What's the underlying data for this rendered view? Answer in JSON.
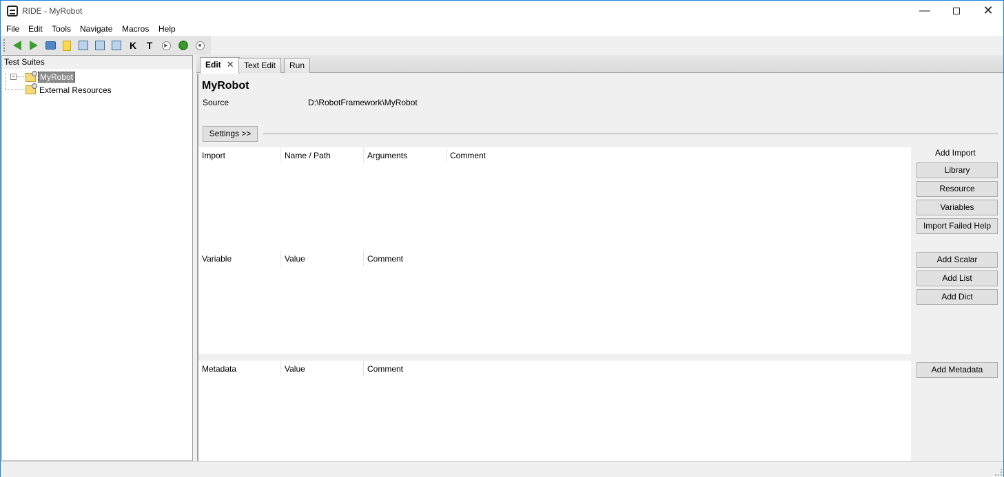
{
  "window": {
    "title": "RIDE - MyRobot",
    "minimize_glyph": "—",
    "close_glyph": "✕"
  },
  "menu": [
    "File",
    "Edit",
    "Tools",
    "Navigate",
    "Macros",
    "Help"
  ],
  "toolbar": {
    "icons": [
      "back-icon",
      "forward-icon",
      "open-folder-icon",
      "new-note-icon",
      "save-icon",
      "save-all-icon",
      "save-as-icon",
      "keyword-search-icon",
      "test-search-icon",
      "run-icon",
      "debug-bug-icon",
      "stop-icon"
    ],
    "k_glyph": "K",
    "t_glyph": "T"
  },
  "tree": {
    "header": "Test Suites",
    "nodes": [
      {
        "label": "MyRobot",
        "selected": true,
        "expanded": true
      },
      {
        "label": "External Resources",
        "selected": false
      }
    ],
    "expander_glyph": "−"
  },
  "tabs": [
    {
      "label": "Edit",
      "active": true,
      "closable": true
    },
    {
      "label": "Text Edit",
      "active": false
    },
    {
      "label": "Run",
      "active": false
    }
  ],
  "editor": {
    "suite_name": "MyRobot",
    "source_label": "Source",
    "source_value": "D:\\RobotFramework\\MyRobot",
    "settings_button": "Settings >>",
    "imports": {
      "columns": [
        "Import",
        "Name / Path",
        "Arguments",
        "Comment"
      ],
      "rows": []
    },
    "variables": {
      "columns": [
        "Variable",
        "Value",
        "Comment"
      ],
      "rows": []
    },
    "metadata": {
      "columns": [
        "Metadata",
        "Value",
        "Comment"
      ],
      "rows": []
    },
    "add_import_label": "Add Import",
    "import_buttons": [
      "Library",
      "Resource",
      "Variables",
      "Import Failed Help"
    ],
    "variable_buttons": [
      "Add Scalar",
      "Add List",
      "Add Dict"
    ],
    "metadata_button": "Add Metadata"
  }
}
